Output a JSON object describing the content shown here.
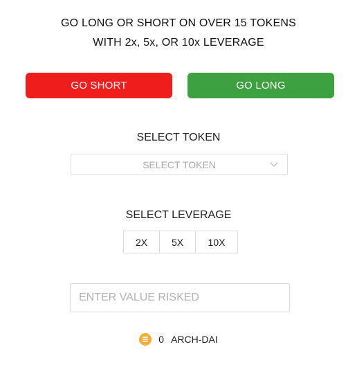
{
  "header": {
    "line1": "GO LONG OR SHORT ON OVER 15 TOKENS",
    "line2": "WITH 2x, 5x, OR 10x LEVERAGE"
  },
  "actions": {
    "short_label": "GO SHORT",
    "long_label": "GO LONG",
    "short_color": "#f01d1d",
    "long_color": "#3ea140"
  },
  "token_select": {
    "title": "SELECT TOKEN",
    "selected_value": "SELECT TOKEN",
    "icon": "chevron-down-icon"
  },
  "leverage": {
    "title": "SELECT LEVERAGE",
    "options": [
      "2X",
      "5X",
      "10X"
    ]
  },
  "value_input": {
    "placeholder": "ENTER VALUE RISKED",
    "value": ""
  },
  "balance": {
    "icon": "dai-coin-icon",
    "icon_color": "#f5ac37",
    "amount": "0",
    "token": "ARCH-DAI"
  }
}
